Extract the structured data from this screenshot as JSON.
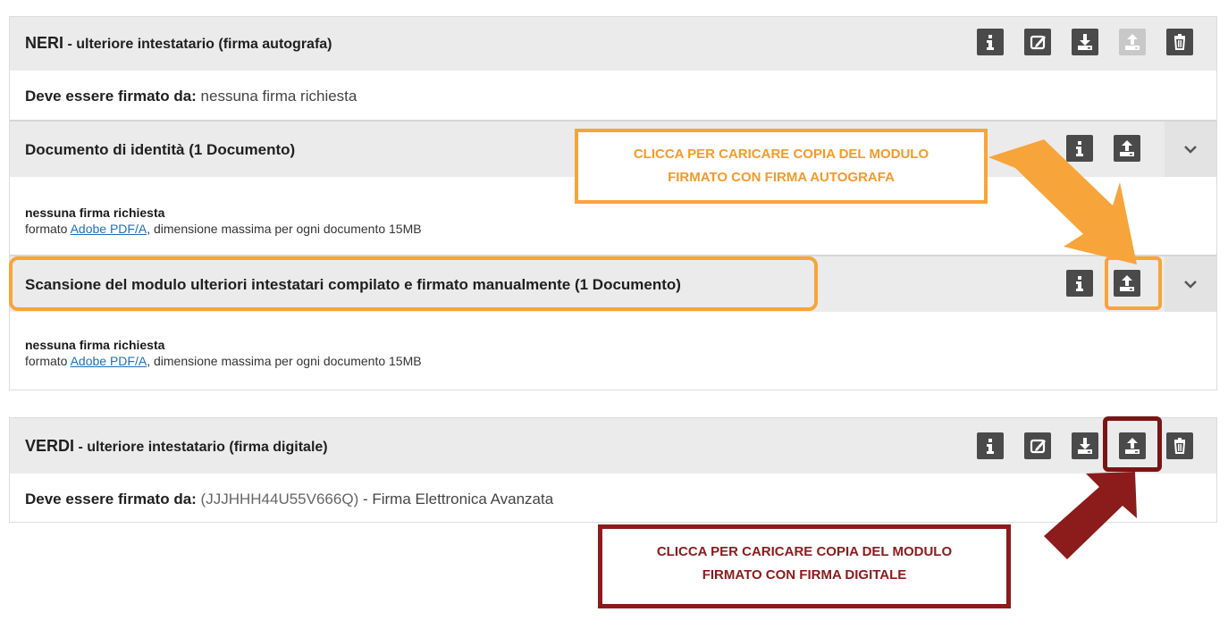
{
  "neri": {
    "surname": "NERI",
    "role": " - ulteriore intestatario (firma autografa)",
    "signed_by_label": "Deve essere firmato da:",
    "signed_by_value": " nessuna firma richiesta",
    "sections": [
      {
        "title": "Documento di identità (1 Documento)",
        "signature": "nessuna firma richiesta",
        "format_prefix": "formato ",
        "format_link": "Adobe PDF/A",
        "format_suffix": ", dimensione massima per ogni documento 15MB"
      },
      {
        "title": "Scansione del modulo ulteriori intestatari compilato e firmato manualmente (1 Documento)",
        "signature": "nessuna firma richiesta",
        "format_prefix": "formato ",
        "format_link": "Adobe PDF/A",
        "format_suffix": ", dimensione massima per ogni documento 15MB"
      }
    ]
  },
  "verdi": {
    "surname": "VERDI",
    "role": " - ulteriore intestatario (firma digitale)",
    "signed_by_label": "Deve essere firmato da:",
    "signed_by_code": " (JJJHHH44U55V666Q)",
    "signed_by_value": " - Firma Elettronica Avanzata"
  },
  "callouts": {
    "orange": [
      "CLICCA PER CARICARE COPIA DEL MODULO",
      "FIRMATO CON FIRMA AUTOGRAFA"
    ],
    "red": [
      "CLICCA PER CARICARE COPIA DEL MODULO",
      "FIRMATO CON FIRMA DIGITALE"
    ]
  },
  "colors": {
    "highlight_orange": "#f7a43b",
    "highlight_red": "#8c1b1b",
    "button_dark": "#4a4a4a",
    "button_disabled": "#c8c8c8",
    "header_bg": "#ebebeb",
    "link": "#1f6fb6"
  },
  "icons": [
    "info-icon",
    "edit-icon",
    "download-icon",
    "upload-icon",
    "trash-icon",
    "chevron-down-icon"
  ]
}
